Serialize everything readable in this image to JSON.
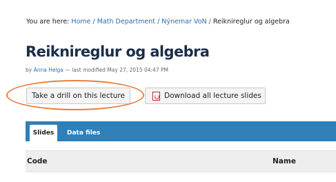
{
  "breadcrumb": {
    "prefix": "You are here:",
    "items": [
      "Home",
      "Math Department",
      "Nýnemar VoN",
      "Reiknireglur og algebra"
    ],
    "separator": "/"
  },
  "page": {
    "title": "Reiknireglur og algebra",
    "byline_prefix": "by",
    "author": "Anna Helga",
    "modified": "— last modified May 27, 2015 04:47 PM"
  },
  "actions": {
    "drill_label": "Take a drill on this lecture",
    "download_label": "Download all lecture slides",
    "download_icon": "pdf-icon"
  },
  "highlight": {
    "color": "#e87e3e",
    "shape": "ellipse",
    "target": "Take a drill on this lecture"
  },
  "tabs": [
    {
      "label": "Slides",
      "active": true
    },
    {
      "label": "Data files",
      "active": false
    }
  ],
  "table": {
    "columns": [
      "Code",
      "Name"
    ]
  },
  "colors": {
    "tab_bar": "#2f80b9",
    "link": "#2a6fb0",
    "title": "#1c2e4a"
  }
}
